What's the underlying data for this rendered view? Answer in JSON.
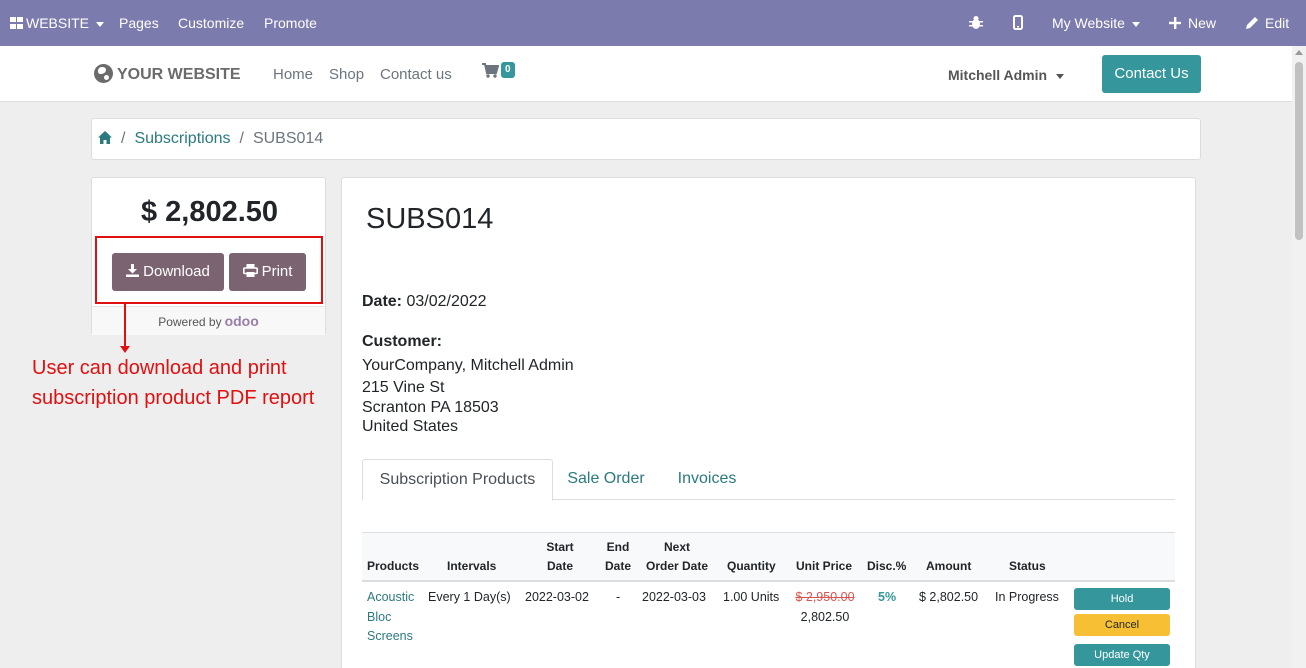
{
  "topbar": {
    "website_menu": "WEBSITE",
    "pages": "Pages",
    "customize": "Customize",
    "promote": "Promote",
    "my_website": "My Website",
    "new": "New",
    "edit": "Edit"
  },
  "navbar": {
    "logo": "YOUR WEBSITE",
    "links": [
      "Home",
      "Shop",
      "Contact us"
    ],
    "cart_count": "0",
    "user": "Mitchell Admin",
    "contact_button": "Contact Us"
  },
  "breadcrumb": {
    "link": "Subscriptions",
    "current": "SUBS014"
  },
  "sidebar": {
    "amount": "$ 2,802.50",
    "download": "Download",
    "print": "Print",
    "powered_by": "Powered by",
    "odoo": "odoo"
  },
  "annotation": "User can download and print subscription product PDF report",
  "document": {
    "title": "SUBS014",
    "date_label": "Date:",
    "date_value": "03/02/2022",
    "customer_label": "Customer:",
    "address": [
      "YourCompany, Mitchell Admin",
      "215 Vine St",
      "Scranton PA 18503",
      "United States"
    ]
  },
  "tabs": [
    "Subscription Products",
    "Sale Order",
    "Invoices"
  ],
  "table": {
    "headers": {
      "products": "Products",
      "intervals": "Intervals",
      "start_1": "Start",
      "start_2": "Date",
      "end_1": "End",
      "end_2": "Date",
      "next_1": "Next",
      "next_2": "Order Date",
      "quantity": "Quantity",
      "unit_price": "Unit Price",
      "disc": "Disc.%",
      "amount": "Amount",
      "status": "Status"
    },
    "row": {
      "product_1": "Acoustic",
      "product_2": "Bloc",
      "product_3": "Screens",
      "interval": "Every 1 Day(s)",
      "start": "2022-03-02",
      "end": "-",
      "next": "2022-03-03",
      "quantity": "1.00 Units",
      "old_price": "$ 2,950.00",
      "unit_price": "2,802.50",
      "disc": "5%",
      "amount": "$ 2,802.50",
      "status": "In Progress",
      "hold": "Hold",
      "cancel": "Cancel",
      "update_qty": "Update Qty"
    }
  },
  "colors": {
    "topbar": "#7c7bad",
    "accent": "#35979c",
    "button": "#7c6371",
    "annotation": "#e01010"
  }
}
